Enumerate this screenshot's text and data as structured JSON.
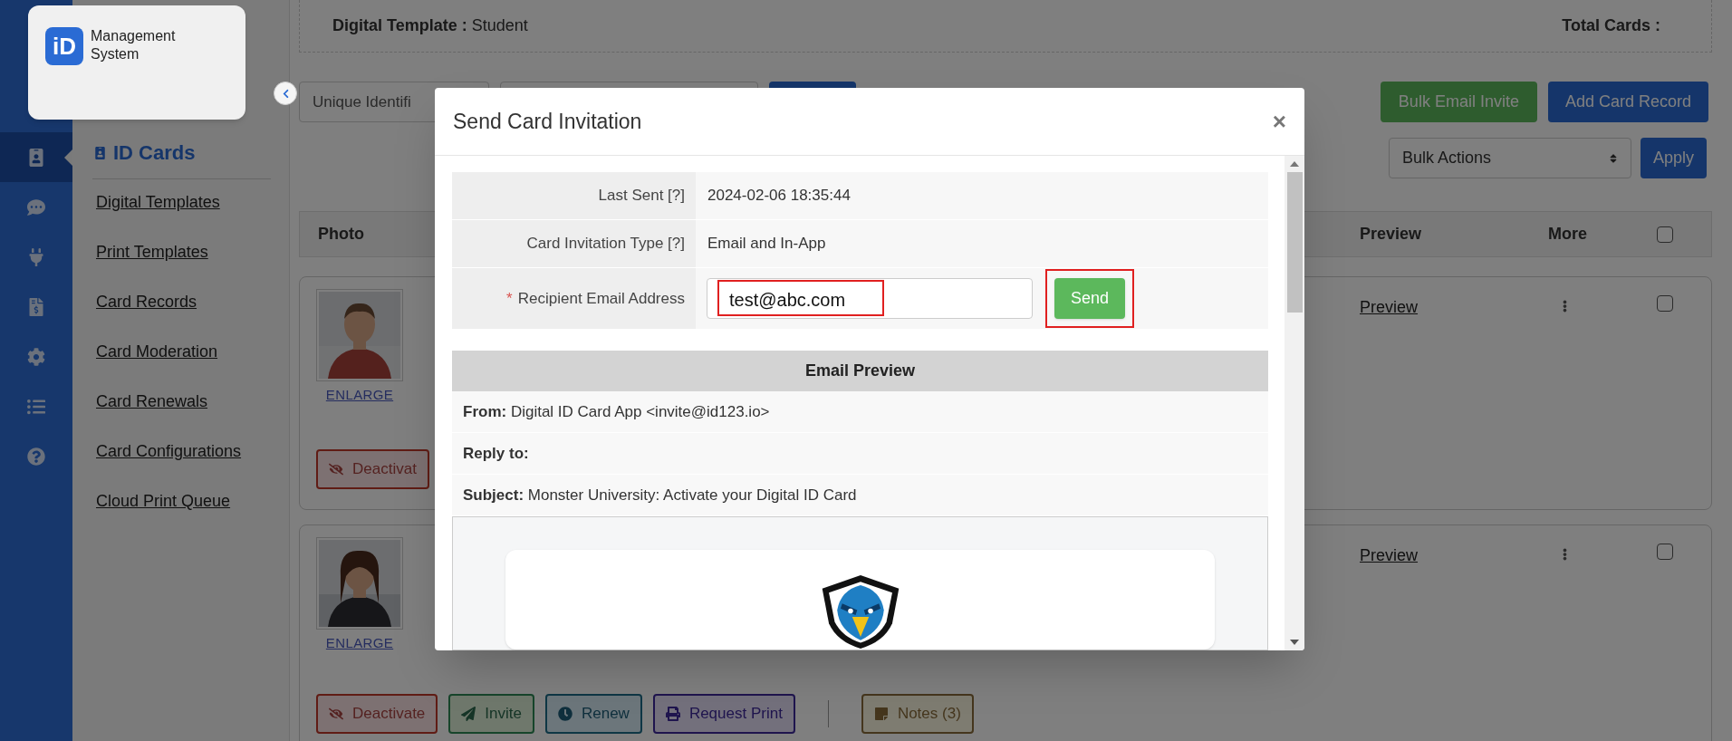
{
  "sidebar": {
    "logo_mark": "iD",
    "logo_text": "Management System",
    "rail": [
      {
        "kind": "id-card",
        "selected": true
      },
      {
        "kind": "chat",
        "selected": false
      },
      {
        "kind": "plug",
        "selected": false
      },
      {
        "kind": "invoice",
        "selected": false
      },
      {
        "kind": "settings",
        "selected": false
      },
      {
        "kind": "list",
        "selected": false
      },
      {
        "kind": "help",
        "selected": false
      }
    ],
    "section_title": "ID Cards",
    "links": [
      "Digital Templates",
      "Print Templates",
      "Card Records",
      "Card Moderation",
      "Card Renewals",
      "Card Configurations",
      "Cloud Print Queue"
    ]
  },
  "summary": {
    "template_label": "Digital Template :",
    "template_value": "Student",
    "total_label": "Total Cards :"
  },
  "toolbar": {
    "identifier_placeholder": "Unique Identifi",
    "bulk_email": "Bulk Email Invite",
    "add_record": "Add Card Record",
    "bulk_actions": "Bulk Actions",
    "apply": "Apply"
  },
  "table": {
    "columns": [
      "Photo",
      "Preview",
      "More"
    ],
    "select_all_checked": false,
    "cards": [
      {
        "photo": {
          "kind": "picture"
        },
        "enlarge": "ENLARGE",
        "preview": "Preview",
        "checked": false,
        "actions": [
          {
            "kind": "deactivate",
            "label": "Deactivat"
          }
        ]
      },
      {
        "photo": {
          "kind": "picture"
        },
        "enlarge": "ENLARGE",
        "preview": "Preview",
        "checked": false,
        "actions": [
          {
            "kind": "deactivate",
            "label": "Deactivate"
          },
          {
            "kind": "invite",
            "label": "Invite"
          },
          {
            "kind": "renew",
            "label": "Renew"
          },
          {
            "kind": "print",
            "label": "Request Print"
          },
          {
            "kind": "notes",
            "label": "Notes (3)"
          }
        ]
      }
    ]
  },
  "modal": {
    "title": "Send Card Invitation",
    "close": "×",
    "info": [
      {
        "label": "Last Sent [?]",
        "value": "2024-02-06 18:35:44"
      },
      {
        "label": "Card Invitation Type [?]",
        "value": "Email and In-App"
      }
    ],
    "email": {
      "required_mark": "*",
      "label": "Recipient Email Address",
      "value": "test@abc.com",
      "highlighted": true
    },
    "send": {
      "label": "Send",
      "highlighted": true
    },
    "preview": {
      "title": "Email Preview",
      "rows": [
        {
          "label": "From:",
          "value": "Digital ID Card App <invite@id123.io>"
        },
        {
          "label": "Reply to:"
        },
        {
          "label": "Subject:",
          "value": "Monster University: Activate your Digital ID Card"
        }
      ]
    }
  }
}
